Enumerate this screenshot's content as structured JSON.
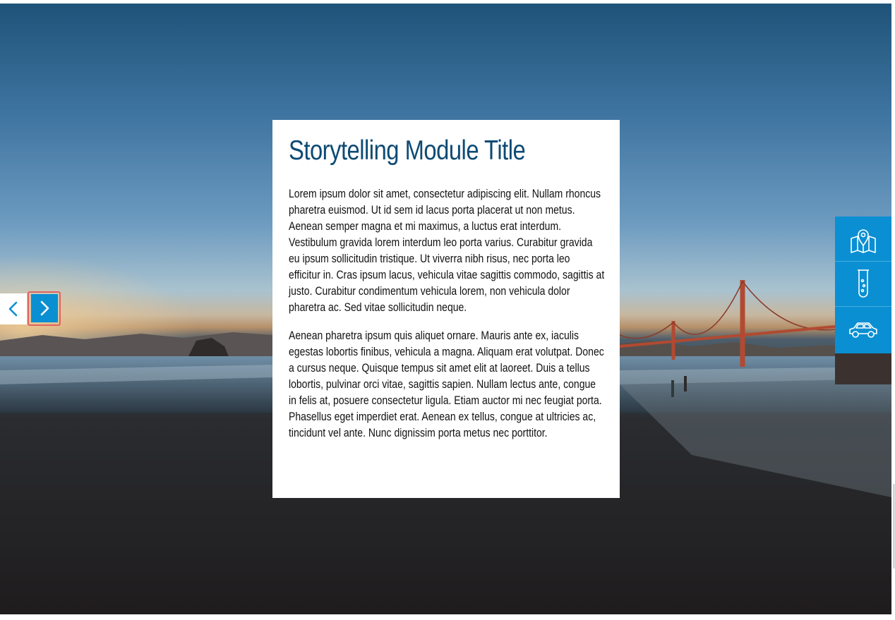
{
  "card": {
    "title": "Storytelling Module Title",
    "paragraph_1": "Lorem ipsum dolor sit amet, consectetur adipiscing elit. Nullam rhoncus pharetra euismod. Ut id sem id lacus porta placerat ut non metus. Aenean semper magna et mi maximus, a luctus erat interdum. Vestibulum gravida lorem interdum leo porta varius. Curabitur gravida eu ipsum sollicitudin tristique. Ut viverra nibh risus, nec porta leo efficitur in. Cras ipsum lacus, vehicula vitae sagittis commodo, sagittis at justo. Curabitur condimentum vehicula lorem, non vehicula dolor pharetra ac. Sed vitae sollicitudin neque.",
    "paragraph_2": "Aenean pharetra ipsum quis aliquet ornare. Mauris ante ex, iaculis egestas lobortis finibus, vehicula a magna. Aliquam erat volutpat. Donec a cursus neque. Quisque tempus sit amet elit at laoreet. Duis a tellus lobortis, pulvinar orci vitae, sagittis sapien. Nullam lectus ante, congue in felis at, posuere consectetur ligula. Etiam auctor mi nec feugiat porta. Phasellus eget imperdiet erat. Aenean ex tellus, congue at ultricies ac, tincidunt vel ante. Nunc dignissim porta metus nec porttitor."
  },
  "navigation": {
    "prev_icon": "chevron-left-icon",
    "next_icon": "chevron-right-icon"
  },
  "side_menu": {
    "items": [
      {
        "icon": "map-pin-icon"
      },
      {
        "icon": "test-tube-icon"
      },
      {
        "icon": "car-icon"
      }
    ]
  },
  "colors": {
    "accent": "#0a8fd3",
    "title": "#0d4a74",
    "focus_ring": "#e0645f"
  }
}
